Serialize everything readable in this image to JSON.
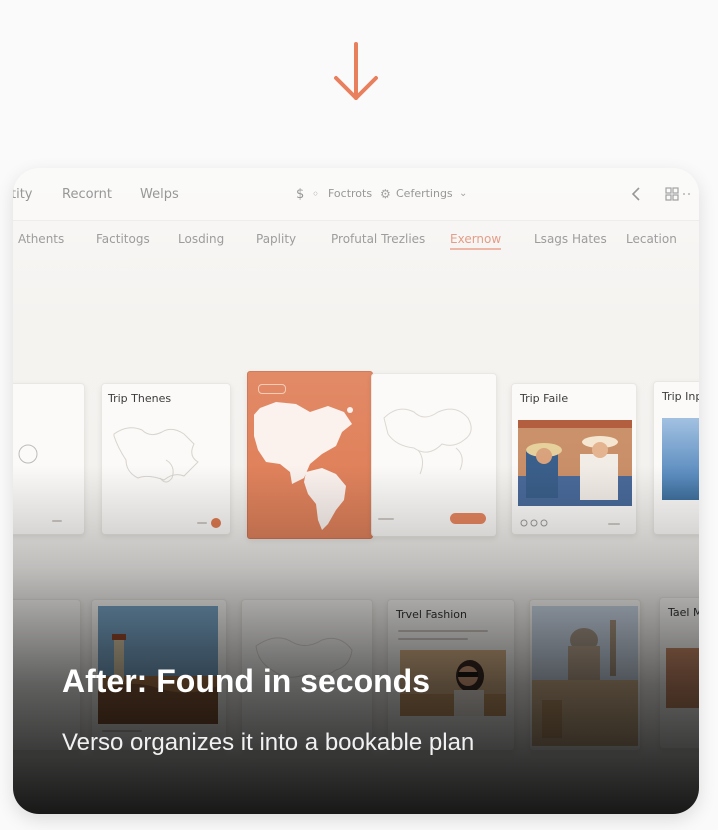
{
  "colors": {
    "accent": "#e8805e",
    "map_cover": "#e0825c",
    "page_bg": "#fafafa"
  },
  "arrow_icon": "arrow-down-icon",
  "app": {
    "topbar": {
      "left_items": [
        "tity",
        "Recornt",
        "Welps"
      ],
      "center_items": [
        "Foctrots",
        "Cefertings"
      ],
      "currency_symbol": "$",
      "icons": [
        "lock-icon",
        "gear-icon",
        "chevron-down-icon",
        "chevron-left-icon",
        "grid-icon"
      ]
    },
    "tabs": [
      "Athents",
      "Factitogs",
      "Losding",
      "Paplity",
      "Profutal Trezlies",
      "Exernow",
      "Lsags Hates",
      "Lecation"
    ],
    "active_tab": "Exernow",
    "tiles": {
      "trip_themes": "Trip Thenes",
      "trip_faile": "Trip Faile",
      "trip_inpl": "Trip Inpl",
      "trvel_fashion": "Trvel Fashion",
      "tael_m": "Tael M"
    }
  },
  "caption": {
    "title": "After: Found in seconds",
    "subtitle": "Verso organizes it into a bookable plan"
  }
}
